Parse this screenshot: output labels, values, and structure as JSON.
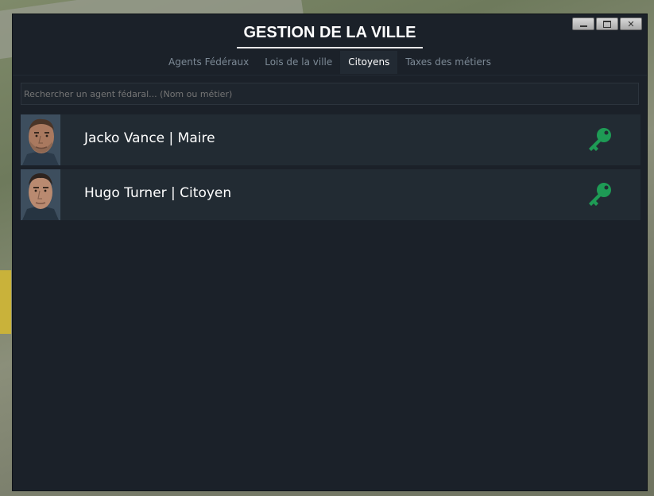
{
  "window": {
    "title": "GESTION DE LA VILLE",
    "controls": {
      "minimize": "minimize",
      "maximize": "maximize",
      "close": "✕"
    }
  },
  "tabs": [
    {
      "label": "Agents Fédéraux",
      "active": false
    },
    {
      "label": "Lois de la ville",
      "active": false
    },
    {
      "label": "Citoyens",
      "active": true
    },
    {
      "label": "Taxes des métiers",
      "active": false
    }
  ],
  "search": {
    "placeholder": "Rechercher un agent fédaral... (Nom ou métier)",
    "value": ""
  },
  "citizens": [
    {
      "name": "Jacko Vance | Maire",
      "icon": "key-icon"
    },
    {
      "name": "Hugo Turner | Citoyen",
      "icon": "key-icon"
    }
  ],
  "colors": {
    "panel": "#1b2129",
    "row": "#222b33",
    "key": "#1e9b55",
    "accent_text": "#ffffff"
  }
}
